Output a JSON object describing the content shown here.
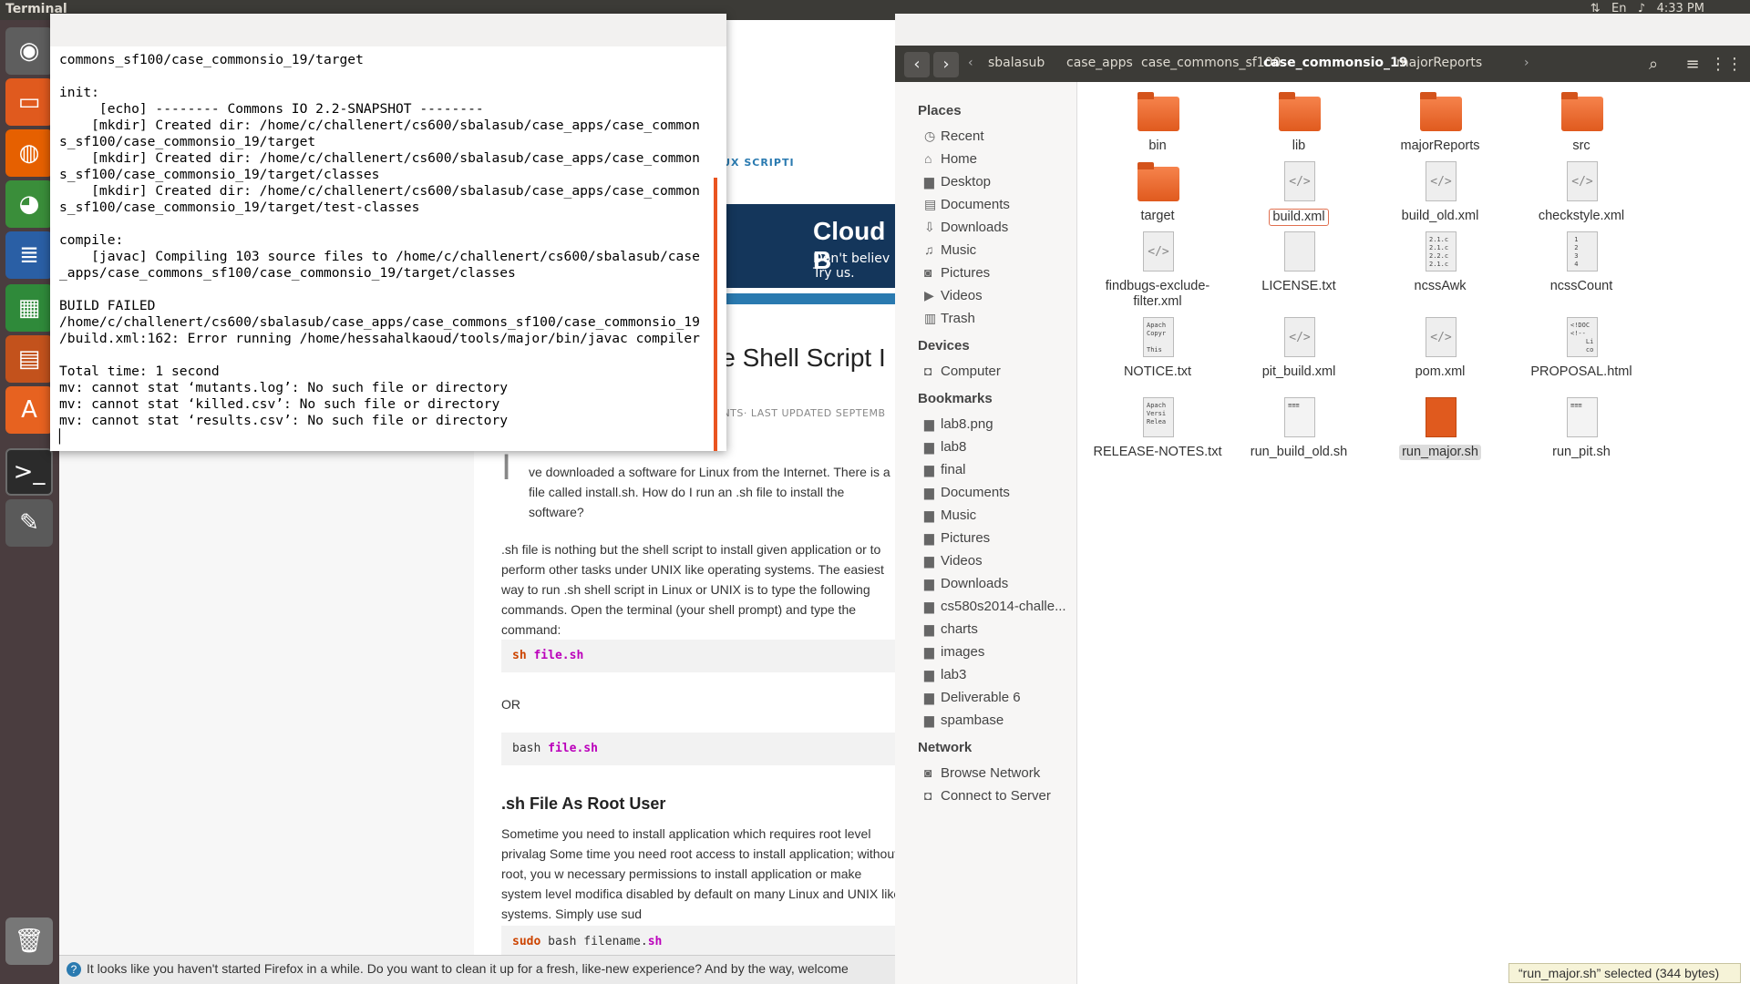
{
  "topbar": {
    "title": "Terminal",
    "clock": "4:33 PM",
    "lang": "En"
  },
  "launcher": [
    {
      "name": "dash-icon",
      "glyph": "◉",
      "color": "#5e5e5e"
    },
    {
      "name": "files-icon",
      "glyph": "▭",
      "color": "#e05a1e"
    },
    {
      "name": "firefox-icon",
      "glyph": "◍",
      "color": "#e66000"
    },
    {
      "name": "chrome-icon",
      "glyph": "◕",
      "color": "#3a8e3a"
    },
    {
      "name": "writer-icon",
      "glyph": "≣",
      "color": "#2a5fa5"
    },
    {
      "name": "calc-icon",
      "glyph": "▦",
      "color": "#2f8a3a"
    },
    {
      "name": "impress-icon",
      "glyph": "▤",
      "color": "#c3521c"
    },
    {
      "name": "software-center-icon",
      "glyph": "A",
      "color": "#e76220"
    },
    {
      "name": "terminal-icon",
      "glyph": ">_",
      "color": "#2b2b2b"
    },
    {
      "name": "text-editor-icon",
      "glyph": "✎",
      "color": "#5a5a5a"
    },
    {
      "name": "trash-icon",
      "glyph": "🗑",
      "color": "#777"
    }
  ],
  "terminal": {
    "output": "commons_sf100/case_commonsio_19/target\n\ninit:\n     [echo] -------- Commons IO 2.2-SNAPSHOT --------\n    [mkdir] Created dir: /home/c/challenert/cs600/sbalasub/case_apps/case_common\ns_sf100/case_commonsio_19/target\n    [mkdir] Created dir: /home/c/challenert/cs600/sbalasub/case_apps/case_common\ns_sf100/case_commonsio_19/target/classes\n    [mkdir] Created dir: /home/c/challenert/cs600/sbalasub/case_apps/case_common\ns_sf100/case_commonsio_19/target/test-classes\n\ncompile:\n    [javac] Compiling 103 source files to /home/c/challenert/cs600/sbalasub/case\n_apps/case_commons_sf100/case_commonsio_19/target/classes\n\nBUILD FAILED\n/home/c/challenert/cs600/sbalasub/case_apps/case_commons_sf100/case_commonsio_19\n/build.xml:162: Error running /home/hessahalkaoud/tools/major/bin/javac compiler\n\nTotal time: 1 second\nmv: cannot stat ‘mutants.log’: No such file or directory\nmv: cannot stat ‘killed.csv’: No such file or directory\nmv: cannot stat ‘results.csv’: No such file or directory\n▏"
  },
  "browser": {
    "nav": "S   FORUM   LINUX SCRIPTI",
    "banner_big": "Cloud B",
    "banner_small1": "Don't believ",
    "banner_small2": "Try us.",
    "title_fragment": "le Shell Script I",
    "meta": "ENTS· LAST UPDATED SEPTEMB",
    "quote": "ve downloaded a software for Linux from the Internet. There is a file called install.sh. How do I run an .sh file to install the software?",
    "para1": ".sh file is nothing but the shell script to install given application or to perform other tasks under UNIX like operating systems. The easiest way to run .sh shell script in Linux or UNIX is to type the following commands. Open the terminal (your shell prompt) and type the command:",
    "code1_kw": "sh",
    "code1_rest": "file.sh",
    "or": "OR",
    "code2_kw": "bash",
    "code2_rest": "file.sh",
    "h2": ".sh File As Root User",
    "para2": "Sometime you need to install application which requires root level privalag Some time you need root access to install application; without root, you w necessary permissions to install application or make system level modifica disabled by default on many Linux and UNIX like systems. Simply use sud",
    "code3_kw": "sudo",
    "code3_mid": "bash filename.",
    "code3_rest": "sh",
    "notification": "It looks like you haven't started Firefox in a while. Do you want to clean it up for a fresh, like-new experience? And by the way, welcome"
  },
  "nautilus": {
    "breadcrumbs": [
      "sbalasub",
      "case_apps",
      "case_commons_sf100",
      "case_commonsio_19",
      "majorReports"
    ],
    "current": "case_commonsio_19",
    "places_title": "Places",
    "places": [
      {
        "icon": "◷",
        "label": "Recent"
      },
      {
        "icon": "⌂",
        "label": "Home"
      },
      {
        "icon": "▆",
        "label": "Desktop"
      },
      {
        "icon": "▤",
        "label": "Documents"
      },
      {
        "icon": "⇩",
        "label": "Downloads"
      },
      {
        "icon": "♫",
        "label": "Music"
      },
      {
        "icon": "◙",
        "label": "Pictures"
      },
      {
        "icon": "▶",
        "label": "Videos"
      },
      {
        "icon": "▥",
        "label": "Trash"
      }
    ],
    "devices_title": "Devices",
    "devices": [
      {
        "icon": "◘",
        "label": "Computer"
      }
    ],
    "bookmarks_title": "Bookmarks",
    "bookmarks": [
      {
        "icon": "▆",
        "label": "lab8.png"
      },
      {
        "icon": "▆",
        "label": "lab8"
      },
      {
        "icon": "▆",
        "label": "final"
      },
      {
        "icon": "▆",
        "label": "Documents"
      },
      {
        "icon": "▆",
        "label": "Music"
      },
      {
        "icon": "▆",
        "label": "Pictures"
      },
      {
        "icon": "▆",
        "label": "Videos"
      },
      {
        "icon": "▆",
        "label": "Downloads"
      },
      {
        "icon": "▆",
        "label": "cs580s2014-challe..."
      },
      {
        "icon": "▆",
        "label": "charts"
      },
      {
        "icon": "▆",
        "label": "images"
      },
      {
        "icon": "▆",
        "label": "lab3"
      },
      {
        "icon": "▆",
        "label": "Deliverable 6"
      },
      {
        "icon": "▆",
        "label": "spambase"
      }
    ],
    "network_title": "Network",
    "network": [
      {
        "icon": "◙",
        "label": "Browse Network"
      },
      {
        "icon": "◘",
        "label": "Connect to Server"
      }
    ],
    "files": [
      {
        "name": "bin",
        "kind": "folder"
      },
      {
        "name": "lib",
        "kind": "folder"
      },
      {
        "name": "majorReports",
        "kind": "folder"
      },
      {
        "name": "src",
        "kind": "folder"
      },
      {
        "name": "target",
        "kind": "folder"
      },
      {
        "name": "build.xml",
        "kind": "xml",
        "ring": true
      },
      {
        "name": "build_old.xml",
        "kind": "xml"
      },
      {
        "name": "checkstyle.xml",
        "kind": "xml"
      },
      {
        "name": "findbugs-exclude-filter.xml",
        "kind": "xml"
      },
      {
        "name": "LICENSE.txt",
        "kind": "blank"
      },
      {
        "name": "ncssAwk",
        "kind": "txt",
        "preview": "2.1.c\n2.1.c\n2.2.c\n2.1.c"
      },
      {
        "name": "ncssCount",
        "kind": "txt",
        "preview": " 1\n 2\n 3\n 4"
      },
      {
        "name": "NOTICE.txt",
        "kind": "txt",
        "preview": "Apach\nCopyr\n\nThis"
      },
      {
        "name": "pit_build.xml",
        "kind": "xml"
      },
      {
        "name": "pom.xml",
        "kind": "xml"
      },
      {
        "name": "PROPOSAL.html",
        "kind": "txt",
        "preview": "<!DOC\n<!--\n    Li\n    co"
      },
      {
        "name": "RELEASE-NOTES.txt",
        "kind": "txt",
        "preview": "Apach\nVersi\nRelea"
      },
      {
        "name": "run_build_old.sh",
        "kind": "sh"
      },
      {
        "name": "run_major.sh",
        "kind": "shsel",
        "selected": true
      },
      {
        "name": "run_pit.sh",
        "kind": "sh"
      }
    ],
    "status": "“run_major.sh” selected  (344 bytes)"
  }
}
